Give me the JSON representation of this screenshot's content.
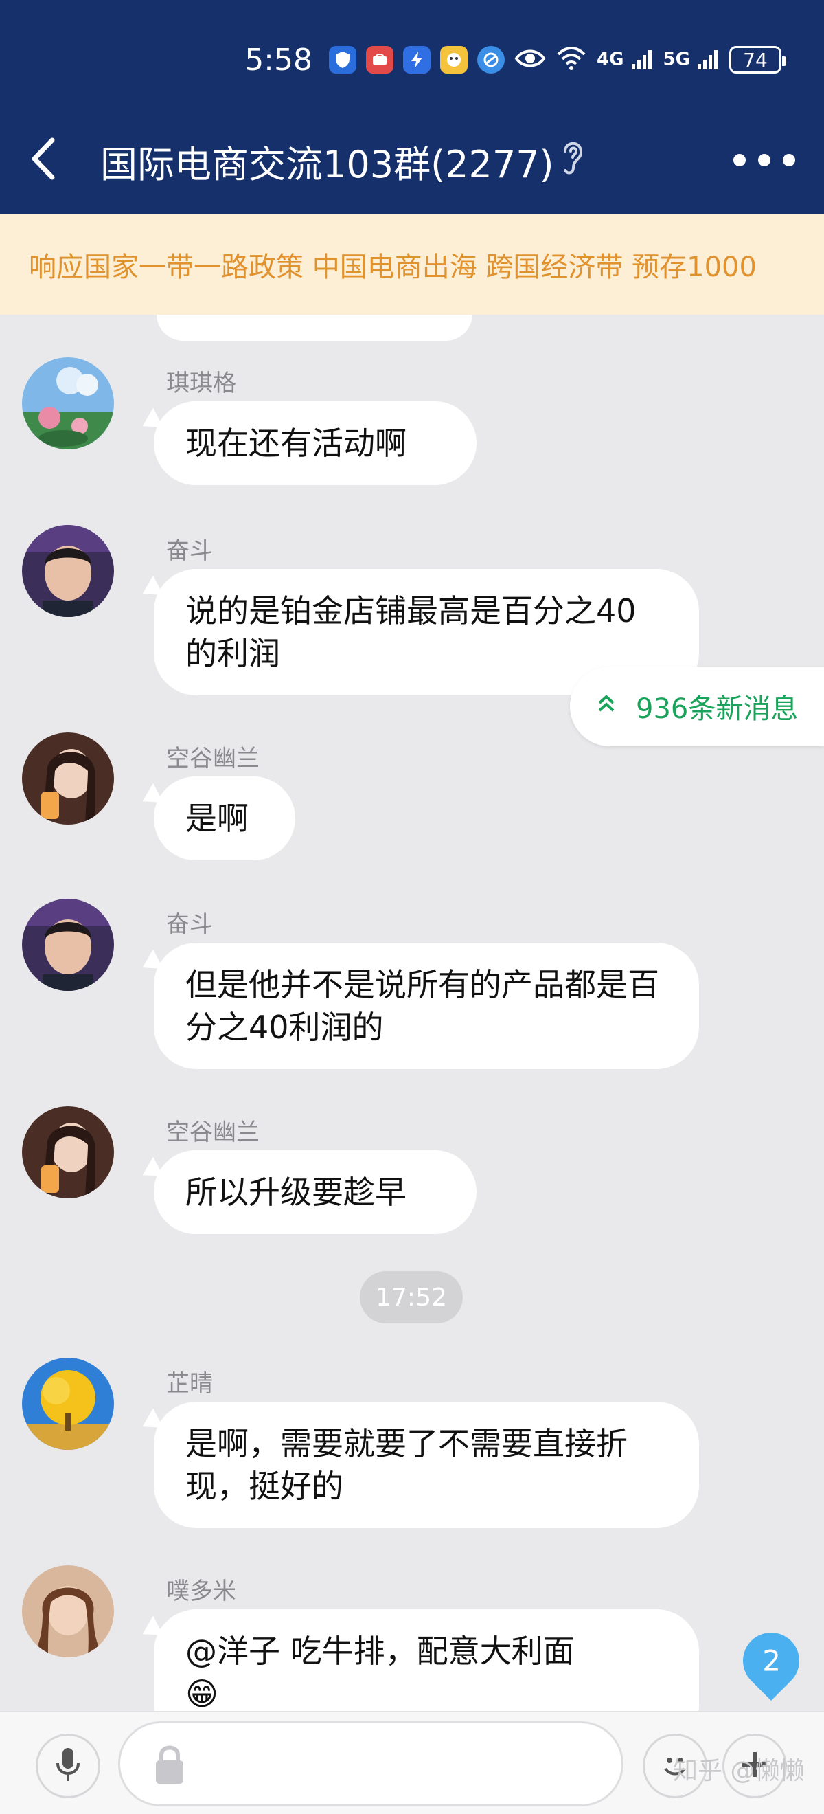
{
  "status_bar": {
    "time": "5:58",
    "network_1": "4G",
    "network_2": "5G",
    "battery": "74",
    "icons": [
      "shield-icon",
      "huawei-icon",
      "bolt-icon",
      "app-icon",
      "browser-icon",
      "eye-icon",
      "wifi-icon"
    ]
  },
  "header": {
    "title": "国际电商交流103群(2277)",
    "ear_icon": "ear-icon",
    "back_icon": "back-arrow-icon",
    "more_icon": "more-icon"
  },
  "notice": {
    "text": "响应国家一带一路政策 中国电商出海 跨国经济带 预存1000"
  },
  "new_messages": {
    "label": "936条新消息"
  },
  "messages": [
    {
      "name": "琪琪格",
      "text": "现在还有活动啊",
      "avatar": "avatar-lotus"
    },
    {
      "name": "奋斗",
      "text": "说的是铂金店铺最高是百分之40的利润",
      "avatar": "avatar-boy"
    },
    {
      "name": "空谷幽兰",
      "text": "是啊",
      "avatar": "avatar-girl"
    },
    {
      "name": "奋斗",
      "text": "但是他并不是说所有的产品都是百分之40利润的",
      "avatar": "avatar-boy"
    },
    {
      "name": "空谷幽兰",
      "text": "所以升级要趁早",
      "avatar": "avatar-girl"
    },
    {
      "name": "芷晴",
      "text": "是啊，需要就要了不需要直接折现，挺好的",
      "avatar": "avatar-tree"
    },
    {
      "name": "噗多米",
      "text": "@洋子 吃牛排，配意大利面",
      "emoji": "😁",
      "avatar": "avatar-portrait"
    }
  ],
  "timestamp": "17:52",
  "unread_badge": "2",
  "watermark": "知乎 @懒懒",
  "colors": {
    "header_bg": "#16306b",
    "notice_bg": "#fcefd6",
    "notice_text": "#e0922e",
    "chat_bg": "#e9e9eb",
    "new_message_text": "#1aa35a",
    "badge": "#4bb0f0"
  }
}
